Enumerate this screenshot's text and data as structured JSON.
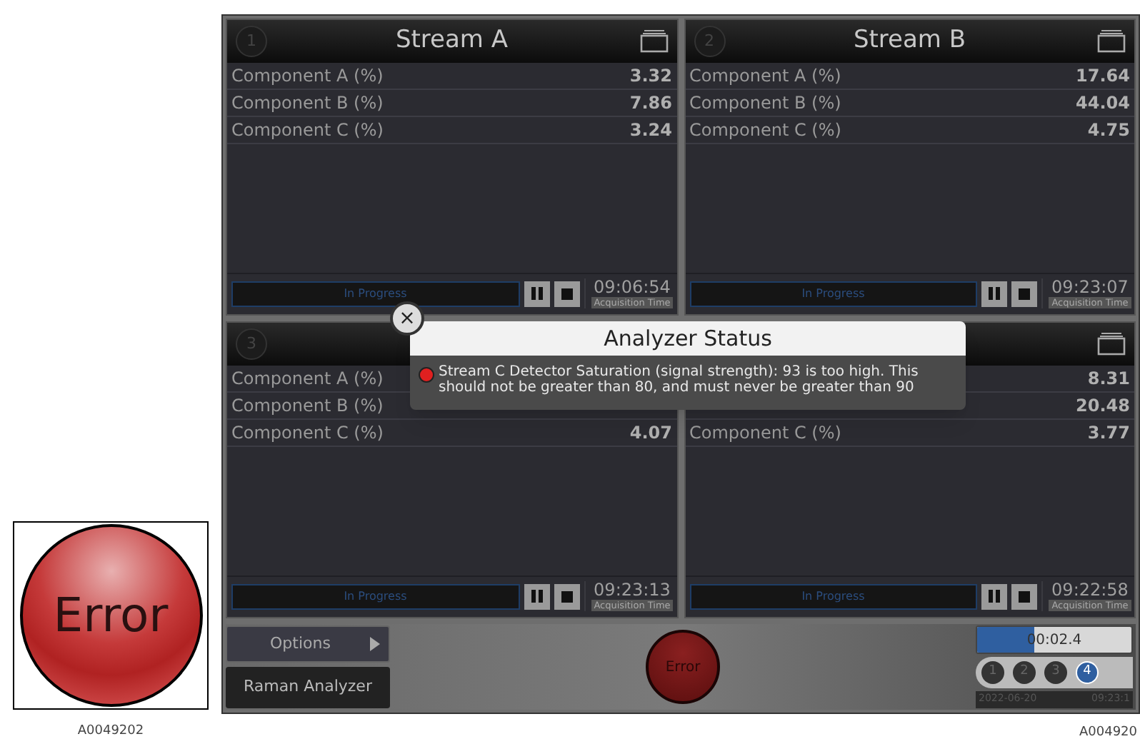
{
  "callout": {
    "label": "Error",
    "caption": "A0049202"
  },
  "panels": [
    {
      "number": "1",
      "title": "Stream A",
      "rows": [
        {
          "label": "Component A (%)",
          "value": "3.32"
        },
        {
          "label": "Component B (%)",
          "value": "7.86"
        },
        {
          "label": "Component C (%)",
          "value": "3.24"
        }
      ],
      "status": "In Progress",
      "time": "09:06:54",
      "time_label": "Acquisition Time"
    },
    {
      "number": "2",
      "title": "Stream B",
      "rows": [
        {
          "label": "Component A (%)",
          "value": "17.64"
        },
        {
          "label": "Component B (%)",
          "value": "44.04"
        },
        {
          "label": "Component C (%)",
          "value": "4.75"
        }
      ],
      "status": "In Progress",
      "time": "09:23:07",
      "time_label": "Acquisition Time"
    },
    {
      "number": "3",
      "rows": [
        {
          "label": "Component A (%)"
        },
        {
          "label": "Component B (%)"
        },
        {
          "label": "Component C (%)",
          "value": "4.07"
        }
      ],
      "status": "In Progress",
      "time": "09:23:13",
      "time_label": "Acquisition Time"
    },
    {
      "rows": [
        {
          "value": "8.31"
        },
        {
          "value": "20.48"
        },
        {
          "label": "Component C (%)",
          "value": "3.77"
        }
      ],
      "status": "In Progress",
      "time": "09:22:58",
      "time_label": "Acquisition Time"
    }
  ],
  "dialog": {
    "close": "×",
    "title": "Analyzer Status",
    "message": "Stream C Detector Saturation (signal strength): 93 is too high. This should not be greater than 80, and must never be greater than 90",
    "color": "#e02020"
  },
  "toolbar": {
    "options": "Options",
    "analyzer": "Raman Analyzer",
    "status": "Error",
    "timer": "00:02.4",
    "level": 0.37,
    "streams": [
      {
        "label": "1",
        "selected": false
      },
      {
        "label": "2",
        "selected": false
      },
      {
        "label": "3",
        "selected": false
      },
      {
        "label": "4",
        "selected": true
      }
    ],
    "date": "2022-06-20",
    "clock": "09:23:1"
  },
  "caption": "A004920"
}
